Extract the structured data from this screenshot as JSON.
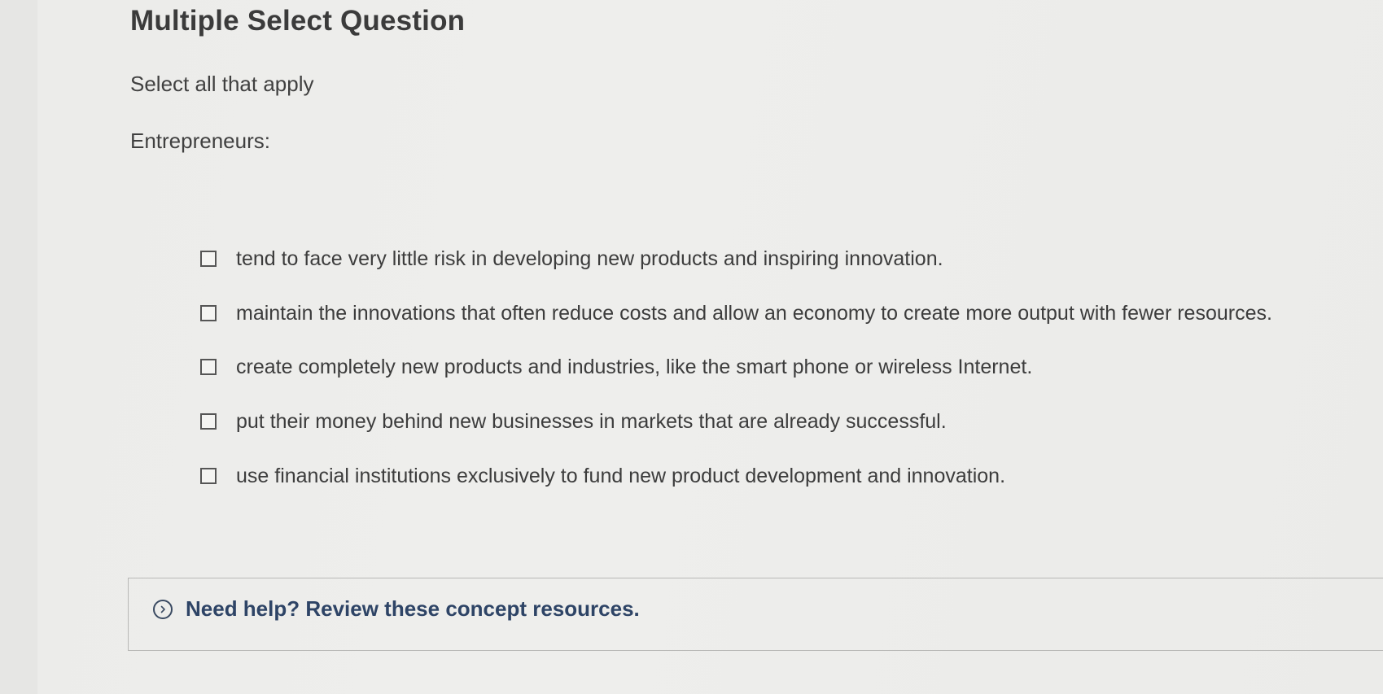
{
  "question": {
    "type_label": "Multiple Select Question",
    "instruction": "Select all that apply",
    "stem": "Entrepreneurs:"
  },
  "options": [
    {
      "text": "tend to face very little risk in developing new products and inspiring innovation.",
      "checked": false
    },
    {
      "text": "maintain the innovations that often reduce costs and allow an economy to create more output with fewer resources.",
      "checked": false
    },
    {
      "text": "create completely new products and industries, like the smart phone or wireless Internet.",
      "checked": false
    },
    {
      "text": "put their money behind new businesses in markets that are already successful.",
      "checked": false
    },
    {
      "text": "use financial institutions exclusively to fund new product development and innovation.",
      "checked": false
    }
  ],
  "help": {
    "label": "Need help? Review these concept resources.",
    "icon": "chevron-right-circle-icon"
  },
  "colors": {
    "background": "#e6e6e4",
    "text": "#3c3c3c",
    "help_link": "#2e4466"
  }
}
